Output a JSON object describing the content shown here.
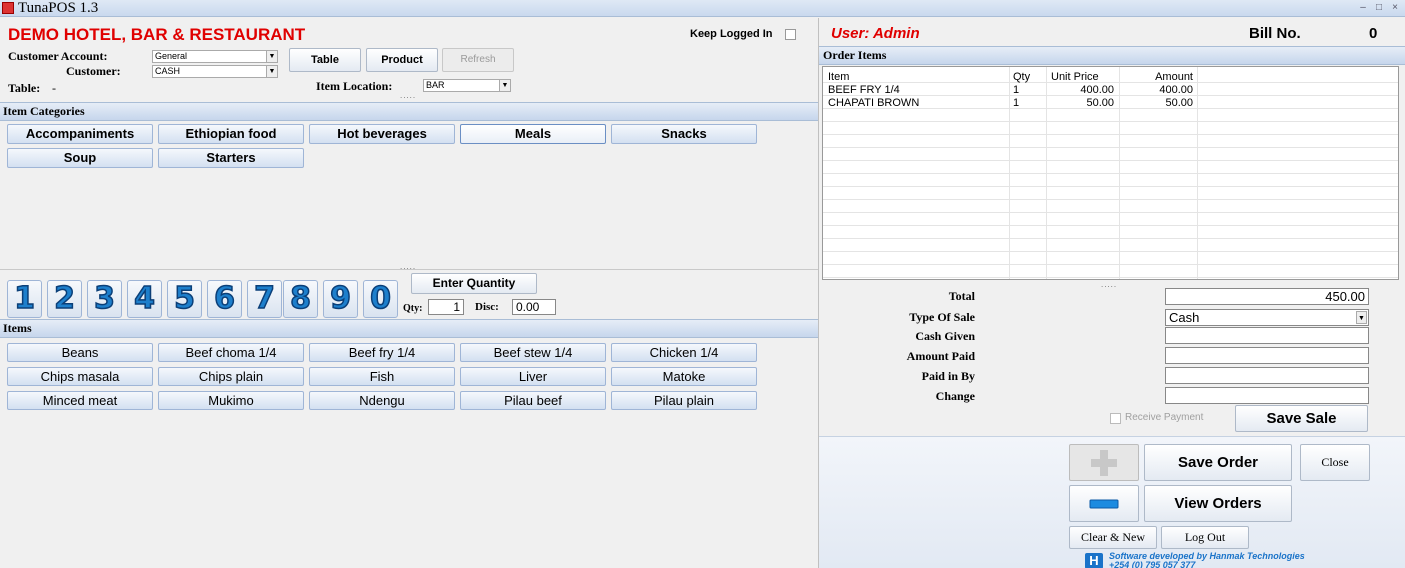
{
  "window": {
    "title": "TunaPOS 1.3",
    "controls": [
      "–",
      "□",
      "×"
    ]
  },
  "header": {
    "hotel_name": "DEMO HOTEL, BAR & RESTAURANT",
    "keep_logged_in": "Keep Logged In",
    "user": "User: Admin",
    "bill_label": "Bill No.",
    "bill_number": "0"
  },
  "customer": {
    "account_label": "Customer Account:",
    "account_value": "General",
    "customer_label": "Customer:",
    "customer_value": "CASH",
    "table_label": "Table:",
    "table_value": "-",
    "location_label": "Item Location:",
    "location_value": "BAR"
  },
  "toolbar": {
    "table": "Table",
    "product": "Product",
    "refresh": "Refresh"
  },
  "categories": {
    "header": "Item Categories",
    "items": [
      "Accompaniments",
      "Ethiopian food",
      "Hot beverages",
      "Meals",
      "Snacks",
      "Soup",
      "Starters"
    ],
    "selected": "Meals"
  },
  "keypad": {
    "digits": [
      "1",
      "2",
      "3",
      "4",
      "5",
      "6",
      "7",
      "8",
      "9",
      "0"
    ],
    "enter_quantity": "Enter Quantity",
    "qty_label": "Qty:",
    "qty_value": "1",
    "disc_label": "Disc:",
    "disc_value": "0.00"
  },
  "items": {
    "header": "Items",
    "list": [
      "Beans",
      "Beef choma 1/4",
      "Beef fry 1/4",
      "Beef stew 1/4",
      "Chicken 1/4",
      "Chips masala",
      "Chips plain",
      "Fish",
      "Liver",
      "Matoke",
      "Minced meat",
      "Mukimo",
      "Ndengu",
      "Pilau beef",
      "Pilau plain"
    ]
  },
  "order": {
    "header": "Order Items",
    "columns": [
      "Item",
      "Qty",
      "Unit Price",
      "Amount"
    ],
    "rows": [
      [
        "BEEF FRY 1/4",
        "1",
        "400.00",
        "400.00"
      ],
      [
        "CHAPATI BROWN",
        "1",
        "50.00",
        "50.00"
      ]
    ]
  },
  "payment": {
    "total_label": "Total",
    "total_value": "450.00",
    "type_label": "Type Of Sale",
    "type_value": "Cash",
    "cash_given_label": "Cash Given",
    "amount_paid_label": "Amount Paid",
    "paid_in_by_label": "Paid in By",
    "change_label": "Change",
    "receive_payment": "Receive Payment",
    "save_sale": "Save Sale"
  },
  "actions": {
    "save_order": "Save Order",
    "close": "Close",
    "view_orders": "View Orders",
    "clear_new": "Clear & New",
    "log_out": "Log Out"
  },
  "footer": {
    "credit_line1": "Software developed by Hanmak Technologies",
    "credit_line2": "+254 (0) 795 057 377"
  },
  "colors": {
    "accent_red": "#e00000",
    "keypad_blue": "#1d7fcc",
    "credit_blue": "#1a73c9"
  }
}
